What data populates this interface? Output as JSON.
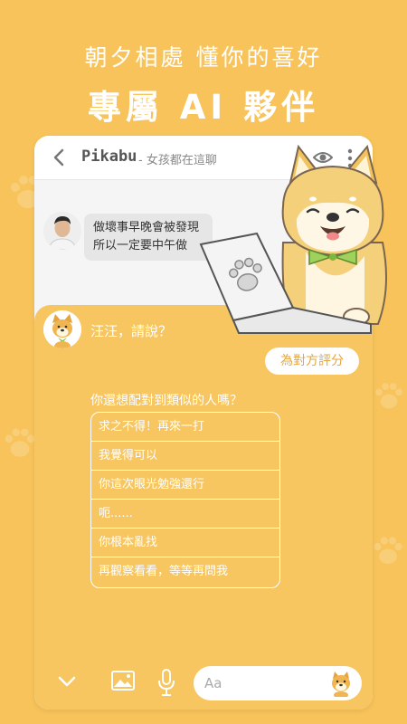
{
  "promo": {
    "tagline": "朝夕相處 懂你的喜好",
    "headline": "專屬 AI 夥伴"
  },
  "chat": {
    "header": {
      "name": "Pikabu",
      "subtitle": "- 女孩都在這聊"
    },
    "incoming_message": {
      "line1": "做壞事早晚會被發現",
      "line2": "所以一定要中午做"
    },
    "bot_prompt": "汪汪，請說？",
    "rate_button": "為對方評分",
    "question": "你還想配對到類似的人嗎？",
    "options": [
      "求之不得！再來一打",
      "我覺得可以",
      "你這次眼光勉強還行",
      "呃......",
      "你根本亂找",
      "再觀察看看，等等再問我"
    ],
    "input_placeholder": "Aa"
  },
  "colors": {
    "background": "#f7c35a",
    "panel": "#f7c660",
    "accent_text": "#e8a53b"
  },
  "icons": [
    "back-arrow-icon",
    "eye-icon",
    "more-icon",
    "chevron-down-icon",
    "image-icon",
    "microphone-icon",
    "shiba-sticker-icon"
  ]
}
